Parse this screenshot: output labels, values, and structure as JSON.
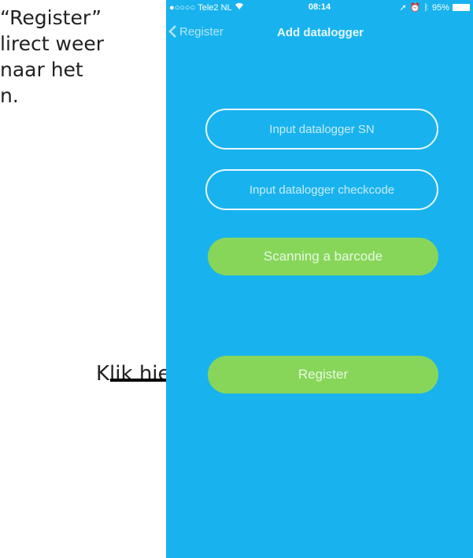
{
  "instruction": {
    "line1": "“Register”",
    "line2": "lirect weer",
    "line3": "naar het",
    "line4": "n."
  },
  "annotation": {
    "label": "Klik hier"
  },
  "status_bar": {
    "carrier": "Tele2 NL",
    "time": "08:14",
    "battery": "95%"
  },
  "nav": {
    "back_label": "Register",
    "title": "Add datalogger"
  },
  "form": {
    "sn_placeholder": "Input datalogger SN",
    "checkcode_placeholder": "Input datalogger checkcode",
    "scan_button": "Scanning a barcode",
    "register_button": "Register"
  },
  "colors": {
    "screen_background": "#18b3ee",
    "button_green": "#87d65a",
    "text": "#222222"
  }
}
